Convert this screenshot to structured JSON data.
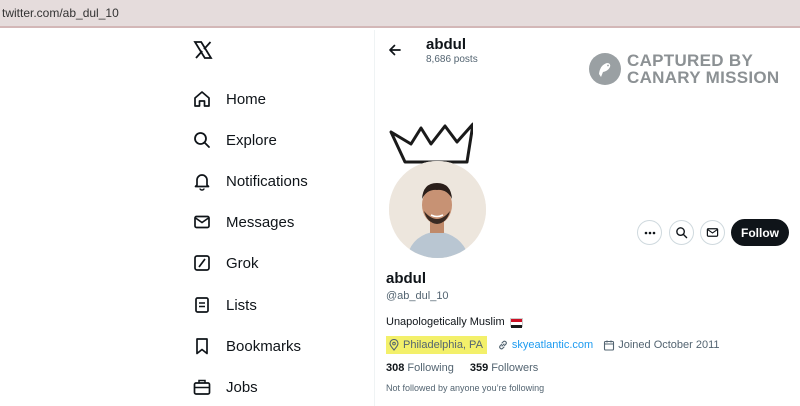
{
  "browser": {
    "url": "twitter.com/ab_dul_10"
  },
  "nav": {
    "logo_icon": "x-logo-icon",
    "items": [
      {
        "label": "Home",
        "icon": "home-icon"
      },
      {
        "label": "Explore",
        "icon": "search-icon"
      },
      {
        "label": "Notifications",
        "icon": "bell-icon"
      },
      {
        "label": "Messages",
        "icon": "envelope-icon"
      },
      {
        "label": "Grok",
        "icon": "grok-icon"
      },
      {
        "label": "Lists",
        "icon": "list-icon"
      },
      {
        "label": "Bookmarks",
        "icon": "bookmark-icon"
      },
      {
        "label": "Jobs",
        "icon": "briefcase-icon"
      }
    ]
  },
  "header": {
    "name": "abdul",
    "posts": "8,686 posts"
  },
  "watermark": {
    "line1": "CAPTURED BY",
    "line2": "CANARY MISSION"
  },
  "profile": {
    "name": "abdul",
    "handle": "@ab_dul_10",
    "bio": "Unapologetically Muslim",
    "location": "Philadelphia, PA",
    "website": "skyeatlantic.com",
    "joined": "Joined October 2011",
    "following_count": "308",
    "following_label": "Following",
    "followers_count": "359",
    "followers_label": "Followers",
    "not_followed": "Not followed by anyone you’re following"
  },
  "actions": {
    "follow": "Follow"
  },
  "colors": {
    "accent": "#1d9bf0",
    "highlight": "#f3f06a",
    "button": "#0f1419"
  }
}
